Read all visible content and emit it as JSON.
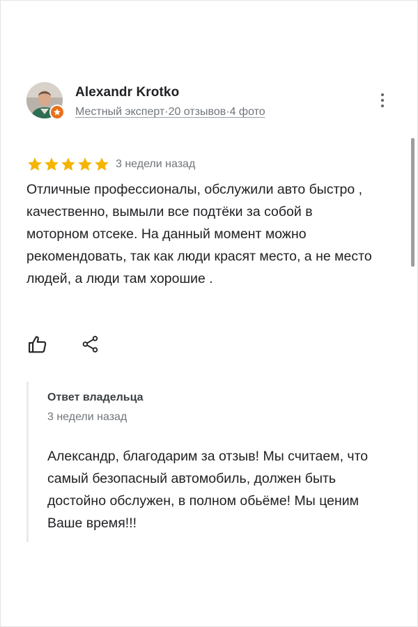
{
  "reviewer": {
    "name": "Alexandr Krotko",
    "subtitle": "Местный эксперт·20 отзывов·4 фото"
  },
  "icons": {
    "more": "more-vert-icon",
    "badge": "local-guide-star-icon",
    "like": "thumbs-up-icon",
    "share": "share-icon",
    "star": "star-icon"
  },
  "colors": {
    "star": "#f4b400",
    "badge": "#e8711c",
    "muted_text": "#70757a",
    "reply_border": "#e8eaed"
  },
  "review": {
    "rating": 5,
    "max_rating": 5,
    "date": "3 недели назад",
    "text": "Отличные профессионалы, обслужили авто быстро , качественно, вымыли все подтёки за собой в моторном отсеке. На данный момент можно рекомендовать, так как люди красят место, а не место людей, а люди там хорошие ."
  },
  "owner_reply": {
    "title": "Ответ владельца",
    "date": "3 недели назад",
    "text": "Александр, благодарим за отзыв! Мы считаем, что самый безопасный автомобиль, должен быть достойно обслужен, в полном обьёме! Мы ценим Ваше время!!!"
  }
}
